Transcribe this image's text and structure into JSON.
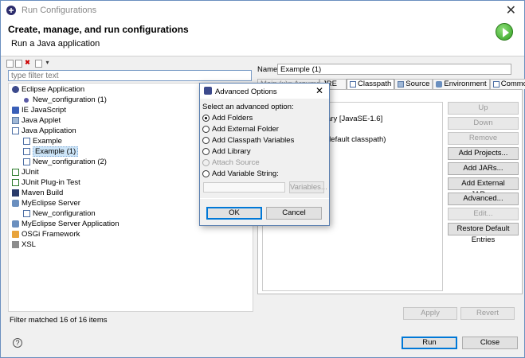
{
  "window": {
    "title": "Run Configurations"
  },
  "header": {
    "title": "Create, manage, and run configurations",
    "subtitle": "Run a Java application"
  },
  "left": {
    "filter_placeholder": "type filter text",
    "tree": [
      {
        "label": "Eclipse Application",
        "icon": "eclipse-icon",
        "level": 0
      },
      {
        "label": "New_configuration (1)",
        "icon": "config-dot-icon",
        "level": 1
      },
      {
        "label": "IE JavaScript",
        "icon": "javascript-icon",
        "level": 0
      },
      {
        "label": "Java Applet",
        "icon": "applet-icon",
        "level": 0
      },
      {
        "label": "Java Application",
        "icon": "java-app-icon",
        "level": 0
      },
      {
        "label": "Example",
        "icon": "java-app-icon",
        "level": 1
      },
      {
        "label": "Example (1)",
        "icon": "java-app-icon",
        "level": 1,
        "selected": true
      },
      {
        "label": "New_configuration (2)",
        "icon": "java-app-icon",
        "level": 1
      },
      {
        "label": "JUnit",
        "icon": "junit-icon",
        "level": 0
      },
      {
        "label": "JUnit Plug-in Test",
        "icon": "junit-plugin-icon",
        "level": 0
      },
      {
        "label": "Maven Build",
        "icon": "maven-icon",
        "level": 0
      },
      {
        "label": "MyEclipse Server",
        "icon": "server-icon",
        "level": 0
      },
      {
        "label": "New_configuration",
        "icon": "java-app-icon",
        "level": 1
      },
      {
        "label": "MyEclipse Server Application",
        "icon": "server-icon",
        "level": 0
      },
      {
        "label": "OSGi Framework",
        "icon": "osgi-icon",
        "level": 0
      },
      {
        "label": "XSL",
        "icon": "xsl-icon",
        "level": 0
      }
    ],
    "status": "Filter matched 16 of 16 items"
  },
  "right": {
    "name_label": "Name:",
    "name_value": "Example (1)",
    "tabs": [
      "Main",
      "Arguments",
      "JRE",
      "Classpath",
      "Source",
      "Environment",
      "Common"
    ],
    "tab_fragments": {
      "main_args": "Main (x)= Arguments",
      "jre": "JRE"
    },
    "active_tab": "Classpath",
    "classpath_visible": [
      "ary [JavaSE-1.6]",
      "default classpath)"
    ],
    "buttons": {
      "up": "Up",
      "down": "Down",
      "remove": "Remove",
      "add_projects": "Add Projects...",
      "add_jars": "Add JARs...",
      "add_external_jars": "Add External JARs...",
      "advanced": "Advanced...",
      "edit": "Edit...",
      "restore": "Restore Default Entries",
      "apply": "Apply",
      "revert": "Revert"
    }
  },
  "footer": {
    "run": "Run",
    "close": "Close"
  },
  "dialog": {
    "title": "Advanced Options",
    "label": "Select an advanced option:",
    "options": [
      {
        "label": "Add Folders",
        "checked": true,
        "disabled": false
      },
      {
        "label": "Add External Folder",
        "checked": false,
        "disabled": false
      },
      {
        "label": "Add Classpath Variables",
        "checked": false,
        "disabled": false
      },
      {
        "label": "Add Library",
        "checked": false,
        "disabled": false
      },
      {
        "label": "Attach Source",
        "checked": false,
        "disabled": true
      },
      {
        "label": "Add Variable String:",
        "checked": false,
        "disabled": false
      }
    ],
    "variables_button": "Variables...",
    "ok": "OK",
    "cancel": "Cancel"
  }
}
